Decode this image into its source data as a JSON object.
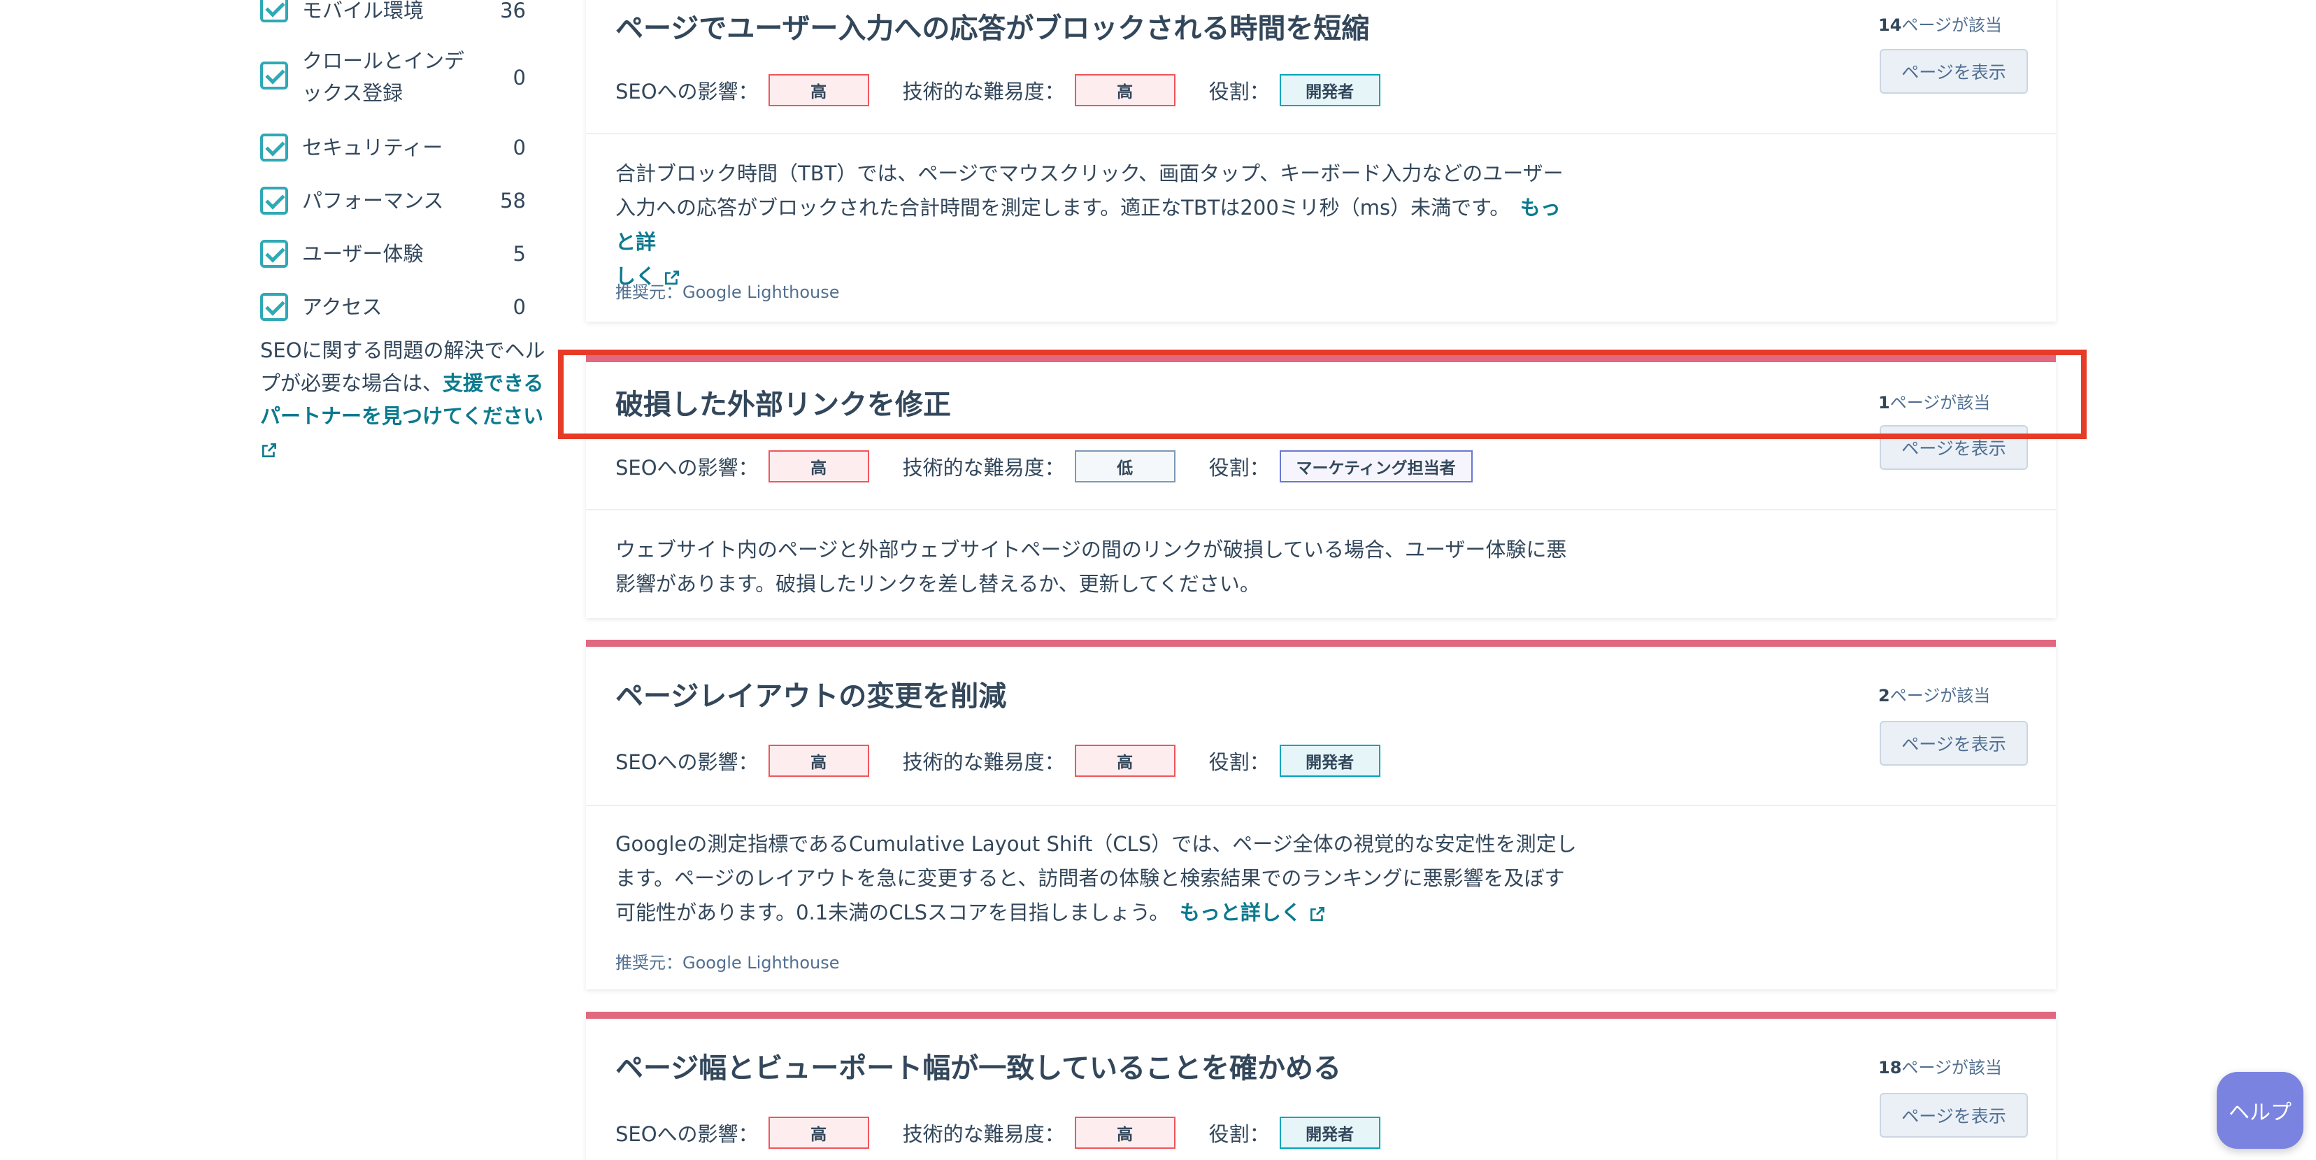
{
  "sidebar": {
    "filters": [
      {
        "label": "モバイル環境",
        "count": "36"
      },
      {
        "label": "クロールとインデックス登録",
        "count": "0"
      },
      {
        "label": "セキュリティー",
        "count": "0"
      },
      {
        "label": "パフォーマンス",
        "count": "58"
      },
      {
        "label": "ユーザー体験",
        "count": "5"
      },
      {
        "label": "アクセス",
        "count": "0"
      }
    ],
    "help_text": "SEOに関する問題の解決でヘルプが必要な場合は、",
    "help_link": "支援できるパートナーを見つけてください"
  },
  "labels": {
    "seo_impact": "SEOへの影響：",
    "difficulty": "技術的な難易度：",
    "role": "役割：",
    "view_pages": "ページを表示",
    "pages_suffix": "ページが該当",
    "learn_more": "もっと詳しく"
  },
  "cards": [
    {
      "title": "ページでユーザー入力への応答がブロックされる時間を短縮",
      "page_count": "14",
      "seo": "高",
      "difficulty": "高",
      "role": "開発者",
      "desc": "合計ブロック時間（TBT）では、ページでマウスクリック、画面タップ、キーボード入力などのユーザー入力への応答がブロックされた合計時間を測定します。適正なTBTは200ミリ秒（ms）未満です。",
      "more1": "もっと詳",
      "more2": "しく",
      "source": "推奨元：Google Lighthouse"
    },
    {
      "title": "破損した外部リンクを修正",
      "page_count": "1",
      "seo": "高",
      "difficulty": "低",
      "role": "マーケティング担当者",
      "desc": "ウェブサイト内のページと外部ウェブサイトページの間のリンクが破損している場合、ユーザー体験に悪影響があります。破損したリンクを差し替えるか、更新してください。"
    },
    {
      "title": "ページレイアウトの変更を削減",
      "page_count": "2",
      "seo": "高",
      "difficulty": "高",
      "role": "開発者",
      "desc": "Googleの測定指標であるCumulative Layout Shift（CLS）では、ページ全体の視覚的な安定性を測定します。ページのレイアウトを急に変更すると、訪問者の体験と検索結果でのランキングに悪影響を及ぼす可能性があります。0.1未満のCLSスコアを目指しましょう。",
      "source": "推奨元：Google Lighthouse"
    },
    {
      "title": "ページ幅とビューポート幅が一致していることを確かめる",
      "page_count": "18",
      "seo": "高",
      "difficulty": "高",
      "role": "開発者"
    }
  ],
  "help_button": "ヘルプ"
}
